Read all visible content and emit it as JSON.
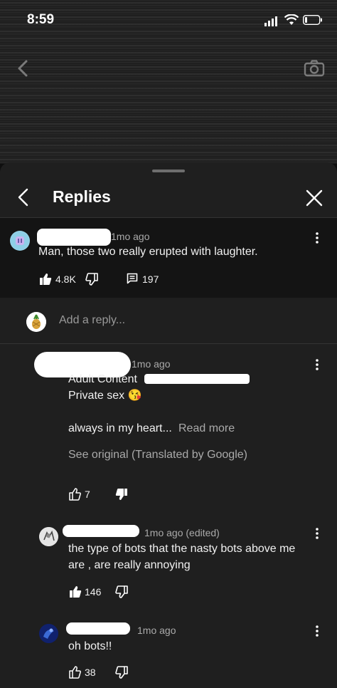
{
  "status_bar": {
    "time": "8:59"
  },
  "header": {
    "title": "Replies"
  },
  "parent_comment": {
    "time": "1mo ago",
    "text": "Man, those two really erupted with laughter.",
    "likes": "4.8K",
    "reply_count": "197"
  },
  "reply_input": {
    "placeholder": "Add a reply..."
  },
  "replies": [
    {
      "time": "1mo ago",
      "line1": "Adult Content",
      "line2": "Private sex 😘",
      "line3": "always in my heart...",
      "read_more": "Read more",
      "see_original": "See original (Translated by Google)",
      "likes": "7"
    },
    {
      "time": "1mo ago (edited)",
      "line1": "the type of bots that the nasty bots above me",
      "line2": "are , are really annoying",
      "likes": "146"
    },
    {
      "time": "1mo ago",
      "line1": "oh bots!!",
      "likes": "38"
    }
  ],
  "colors": {
    "background": "#1f1f1f",
    "parent_background": "#141414",
    "muted_text": "#aaaaaa",
    "accent_dislike": "#ffffff"
  },
  "icons": [
    "signal-icon",
    "wifi-icon",
    "battery-icon",
    "back-icon",
    "camera-icon",
    "close-icon",
    "like-icon",
    "dislike-icon",
    "replies-icon",
    "more-icon"
  ]
}
